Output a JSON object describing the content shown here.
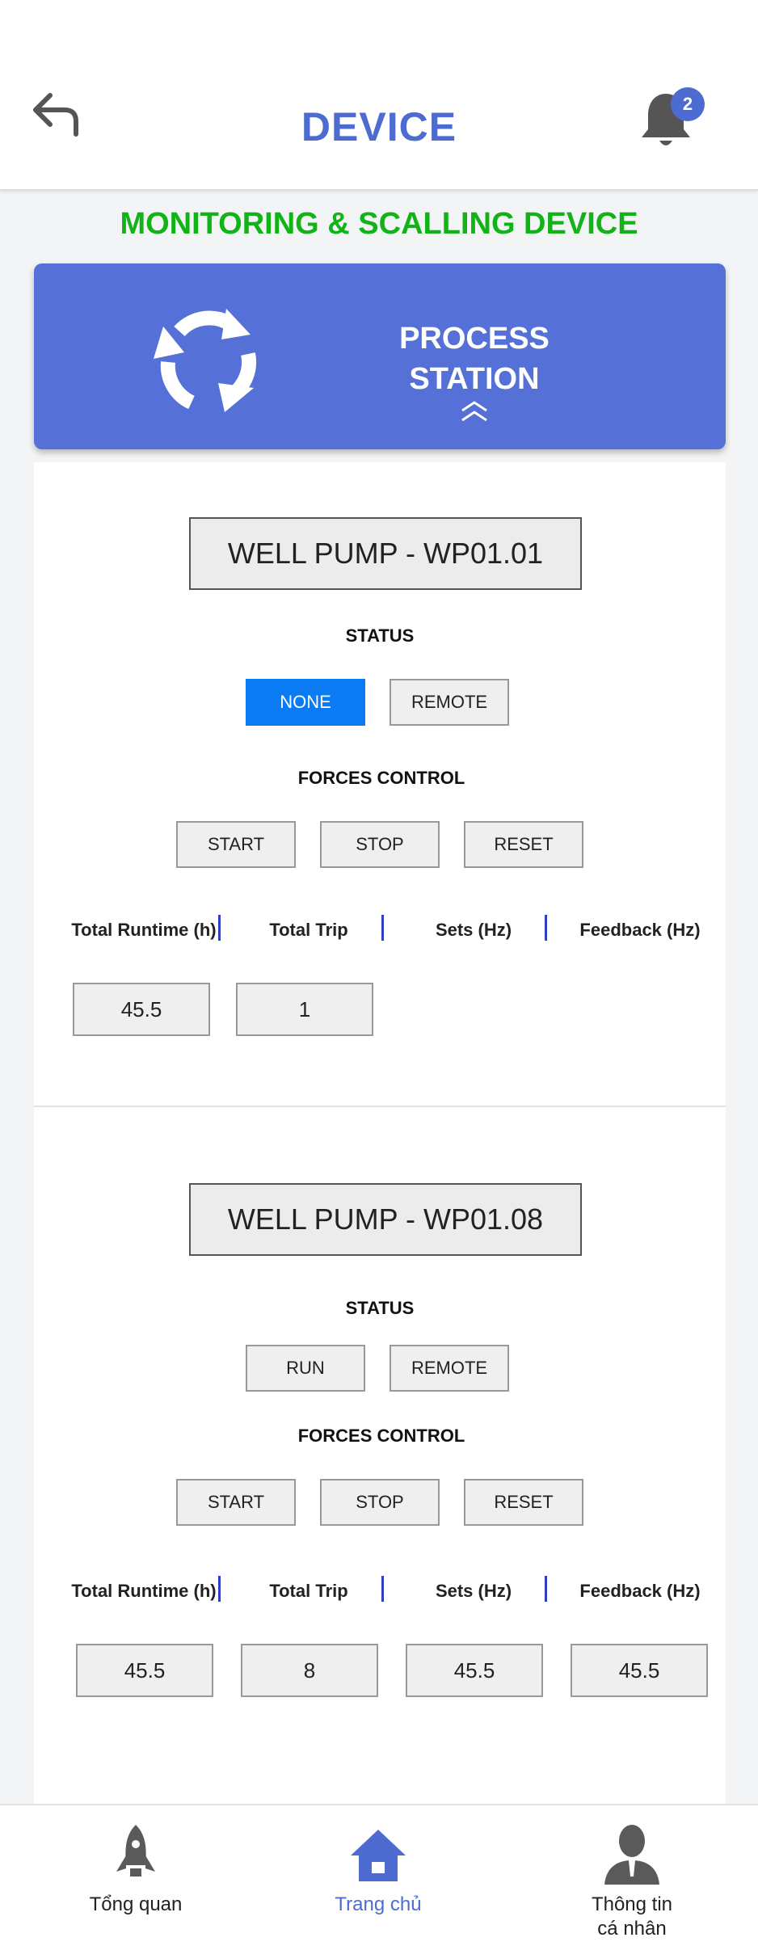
{
  "header": {
    "title": "DEVICE",
    "notification_count": "2"
  },
  "subtitle": "MONITORING & SCALLING DEVICE",
  "station": {
    "line1": "PROCESS",
    "line2": "STATION"
  },
  "pumps": [
    {
      "name": "WELL PUMP - WP01.01",
      "status_label": "STATUS",
      "status_buttons": [
        "NONE",
        "REMOTE"
      ],
      "forces_label": "FORCES CONTROL",
      "controls": [
        "START",
        "STOP",
        "RESET"
      ],
      "columns": [
        "Total Runtime (h)",
        "Total Trip",
        "Sets (Hz)",
        "Feedback (Hz)"
      ],
      "values": [
        "45.5",
        "1"
      ]
    },
    {
      "name": "WELL PUMP - WP01.08",
      "status_label": "STATUS",
      "status_buttons": [
        "RUN",
        "REMOTE"
      ],
      "forces_label": "FORCES CONTROL",
      "controls": [
        "START",
        "STOP",
        "RESET"
      ],
      "columns": [
        "Total Runtime (h)",
        "Total Trip",
        "Sets (Hz)",
        "Feedback (Hz)"
      ],
      "values": [
        "45.5",
        "8",
        "45.5",
        "45.5"
      ]
    }
  ],
  "nav": {
    "overview": "Tổng quan",
    "home": "Trang chủ",
    "profile_line1": "Thông tin",
    "profile_line2": "cá nhân"
  },
  "colors": {
    "accent": "#4d6bd1",
    "subtitle": "#12b317",
    "active_status": "#0a7bf2"
  },
  "icons": [
    "back-arrow-icon",
    "bell-icon",
    "refresh-icon",
    "chevron-up-icon",
    "rocket-icon",
    "home-icon",
    "user-icon"
  ]
}
